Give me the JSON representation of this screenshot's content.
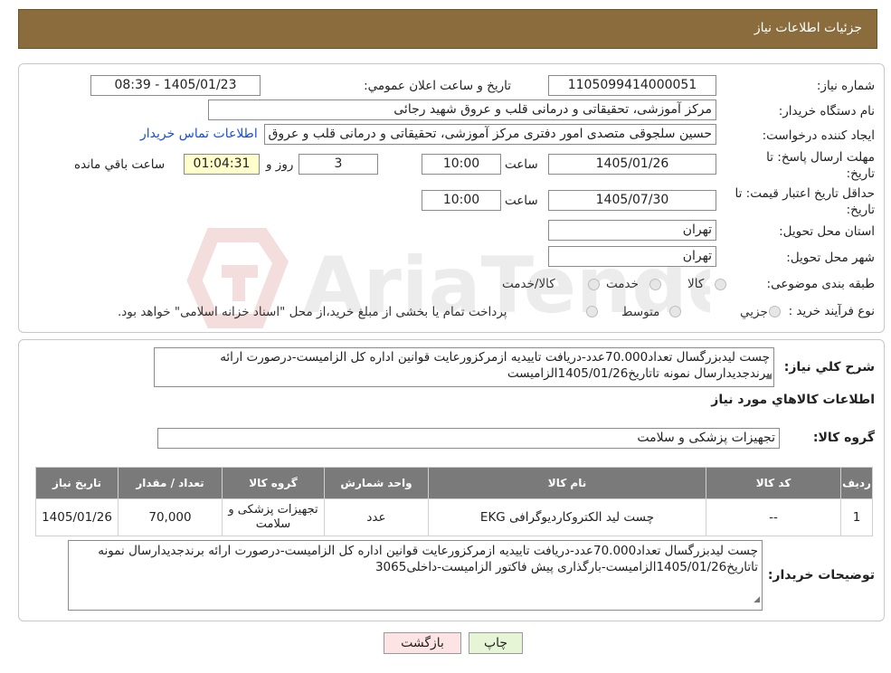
{
  "page_title": "جزئیات اطلاعات نیاز",
  "form": {
    "need_number_label": "شماره نیاز:",
    "need_number": "1105099414000051",
    "announce_label": "تاریخ و ساعت اعلان عمومي:",
    "announce_value": "1405/01/23 - 08:39",
    "buyer_label": "نام دستگاه خريدار:",
    "buyer_value": "مرکز آموزشی، تحقیقاتی و درمانی قلب و عروق شهید رجائی",
    "creator_label": "ايجاد کننده درخواست:",
    "creator_value": "حسین سلجوقی متصدی امور دفتری مرکز آموزشی، تحقیقاتی و درمانی قلب و عروق شهید رجائی",
    "contact_link": "اطلاعات تماس خريدار",
    "deadline_label_1": "مهلت ارسال پاسخ: تا",
    "deadline_label_2": "تاريخ:",
    "deadline_date": "1405/01/26",
    "time_label": "ساعت",
    "deadline_time": "10:00",
    "days_value": "3",
    "days_label": "روز و",
    "remaining_time": "01:04:31",
    "remaining_label": "ساعت باقي مانده",
    "validity_label_1": "حداقل تاريخ اعتبار قيمت: تا",
    "validity_label_2": "تاريخ:",
    "validity_date": "1405/07/30",
    "validity_time": "10:00",
    "province_label": "استان محل تحويل:",
    "province_value": "تهران",
    "city_label": "شهر محل تحويل:",
    "city_value": "تهران",
    "category_label": "طبقه بندی موضوعی:",
    "category_options": [
      "کالا",
      "خدمت",
      "کالا/خدمت"
    ],
    "process_label": "نوع فرآيند خريد :",
    "process_options": [
      "جزيي",
      "متوسط"
    ],
    "process_note": "پرداخت تمام يا بخشی از مبلغ خريد،از محل \"اسناد خزانه اسلامی\" خواهد بود."
  },
  "summary": {
    "label": "شرح کلي نياز:",
    "text": "چست لیدبزرگسال تعداد70.000عدد-دریافت تاییدیه ازمرکزورعایت قوانین اداره کل الزامیست-درصورت ارائه برندجدیدارسال نمونه تاتاریخ1405/01/26الزامیست"
  },
  "goods": {
    "section_title": "اطلاعات کالاهاي مورد نياز",
    "group_label": "گروه کالا:",
    "group_value": "تجهيزات پزشکی و سلامت",
    "columns": [
      "رديف",
      "کد کالا",
      "نام کالا",
      "واحد شمارش",
      "گروه کالا",
      "تعداد / مقدار",
      "تاريخ نياز"
    ],
    "rows": [
      {
        "index": "1",
        "code": "--",
        "name": "چست لید الکتروکاردیوگرافی EKG",
        "unit": "عدد",
        "group": "تجهيزات پزشکی و سلامت",
        "qty": "70,000",
        "date": "1405/01/26"
      }
    ]
  },
  "buyer_notes": {
    "label": "توضيحات خريدار:",
    "text": "چست لیدبزرگسال تعداد70.000عدد-دریافت تاییدیه ازمرکزورعایت قوانین اداره کل الزامیست-درصورت ارائه برندجدیدارسال نمونه تاتاریخ1405/01/26الزامیست-بارگذاری پیش فاکتور الزامیست-داخلی3065"
  },
  "buttons": {
    "print": "چاپ",
    "back": "بازگشت"
  },
  "colors": {
    "header_bg": "#8b6c3c",
    "table_header_bg": "#7a7a7a",
    "link": "#1a4fd6",
    "back_button_bg": "#fde4e4",
    "print_button_bg": "#e6f5d6"
  }
}
